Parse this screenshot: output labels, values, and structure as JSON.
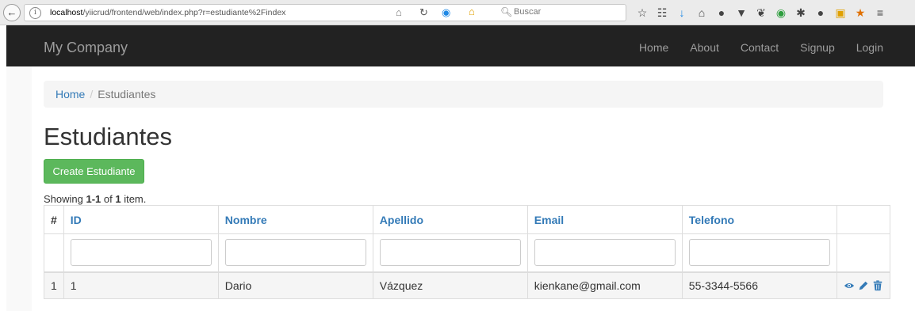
{
  "browser": {
    "url_host": "localhost",
    "url_path": "/yiicrud/frontend/web/index.php?r=estudiante%2Findex",
    "search_placeholder": "Buscar"
  },
  "navbar": {
    "brand": "My Company",
    "links": [
      "Home",
      "About",
      "Contact",
      "Signup",
      "Login"
    ]
  },
  "breadcrumb": {
    "home": "Home",
    "separator": "/",
    "current": "Estudiantes"
  },
  "page": {
    "title": "Estudiantes",
    "create_button": "Create Estudiante",
    "summary_prefix": "Showing ",
    "summary_range": "1-1",
    "summary_mid": " of ",
    "summary_total": "1",
    "summary_suffix": " item."
  },
  "table": {
    "columns": [
      "#",
      "ID",
      "Nombre",
      "Apellido",
      "Email",
      "Telefono"
    ],
    "rows": [
      {
        "num": "1",
        "id": "1",
        "nombre": "Dario",
        "apellido": "Vázquez",
        "email": "kienkane@gmail.com",
        "telefono": "55-3344-5566"
      }
    ]
  },
  "colors": {
    "navbar_bg": "#222222",
    "link": "#337ab7",
    "success": "#5cb85c"
  }
}
